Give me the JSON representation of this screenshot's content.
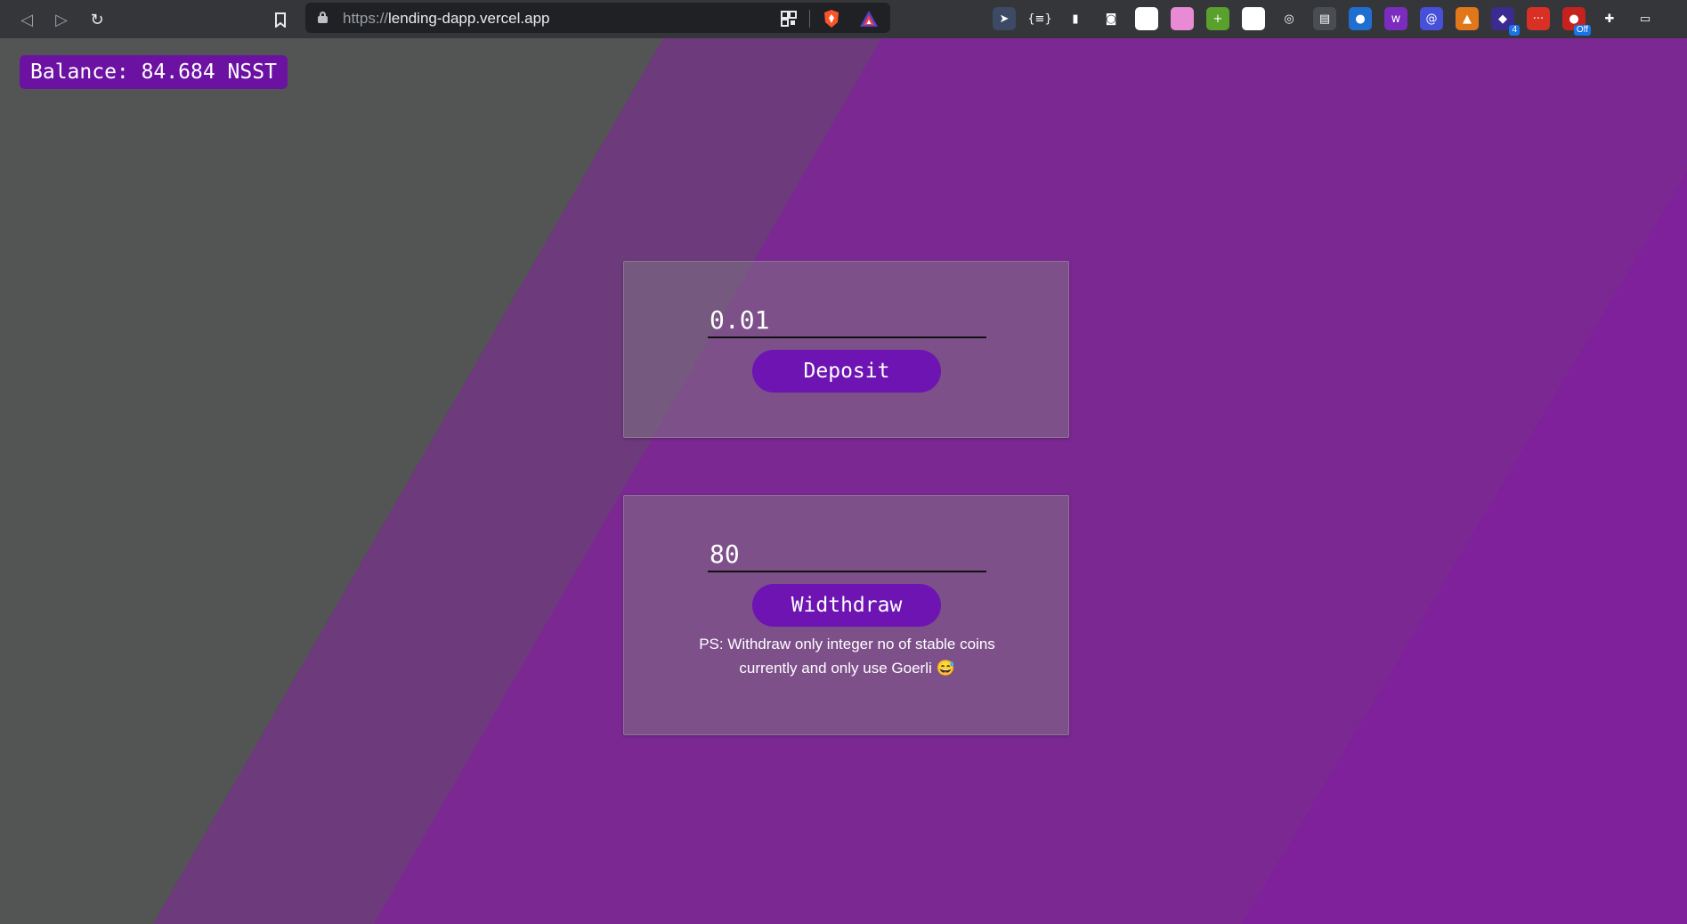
{
  "browser": {
    "url_scheme": "https://",
    "url_host": "lending-dapp.vercel.app",
    "extensions": [
      {
        "icon": "cursor-extension-icon",
        "color": "#3c4a66",
        "glyph": "➤"
      },
      {
        "icon": "braces-extension-icon",
        "color": "#35363a",
        "glyph": "{≡}"
      },
      {
        "icon": "mouse-extension-icon",
        "color": "#35363a",
        "glyph": "▮"
      },
      {
        "icon": "camera-extension-icon",
        "color": "#35363a",
        "glyph": "◙"
      },
      {
        "icon": "green-search-extension-icon",
        "color": "#ffffff",
        "glyph": "◎"
      },
      {
        "icon": "gradient-extension-icon",
        "color": "#e88ad4",
        "glyph": ""
      },
      {
        "icon": "green-plus-extension-icon",
        "color": "#5aa02c",
        "glyph": "+"
      },
      {
        "icon": "chart-extension-icon",
        "color": "#ffffff",
        "glyph": "▥"
      },
      {
        "icon": "target-extension-icon",
        "color": "#35363a",
        "glyph": "◎"
      },
      {
        "icon": "window-extension-icon",
        "color": "#4a4d52",
        "glyph": "▤"
      },
      {
        "icon": "globe-extension-icon",
        "color": "#1f6fd1",
        "glyph": "●"
      },
      {
        "icon": "w-extension-icon",
        "color": "#7b2cbf",
        "glyph": "w"
      },
      {
        "icon": "at-extension-icon",
        "color": "#4650d8",
        "glyph": "@"
      },
      {
        "icon": "fox-extension-icon",
        "color": "#e2761b",
        "glyph": "▲"
      },
      {
        "icon": "cube-extension-icon",
        "color": "#3b2a8f",
        "glyph": "◆",
        "badge": "4"
      },
      {
        "icon": "dots-extension-icon",
        "color": "#d93025",
        "glyph": "···"
      },
      {
        "icon": "record-extension-icon",
        "color": "#c5221f",
        "glyph": "●",
        "badge": "Off"
      },
      {
        "icon": "puzzle-extension-icon",
        "color": "#35363a",
        "glyph": "✚"
      },
      {
        "icon": "wallet-extension-icon",
        "color": "#35363a",
        "glyph": "▭"
      }
    ]
  },
  "balance": {
    "label": "Balance:",
    "amount": "84.684",
    "unit": "NSST"
  },
  "deposit": {
    "input_value": "0.01",
    "button_label": "Deposit"
  },
  "withdraw": {
    "input_value": "80",
    "button_label": "Widthdraw",
    "note_line1": "PS: Withdraw only integer no of stable coins",
    "note_line2": "currently and only use Goerli 😅"
  },
  "colors": {
    "accent": "#6d14b3",
    "background_purple": "#7b2893",
    "background_gray": "#545556"
  }
}
